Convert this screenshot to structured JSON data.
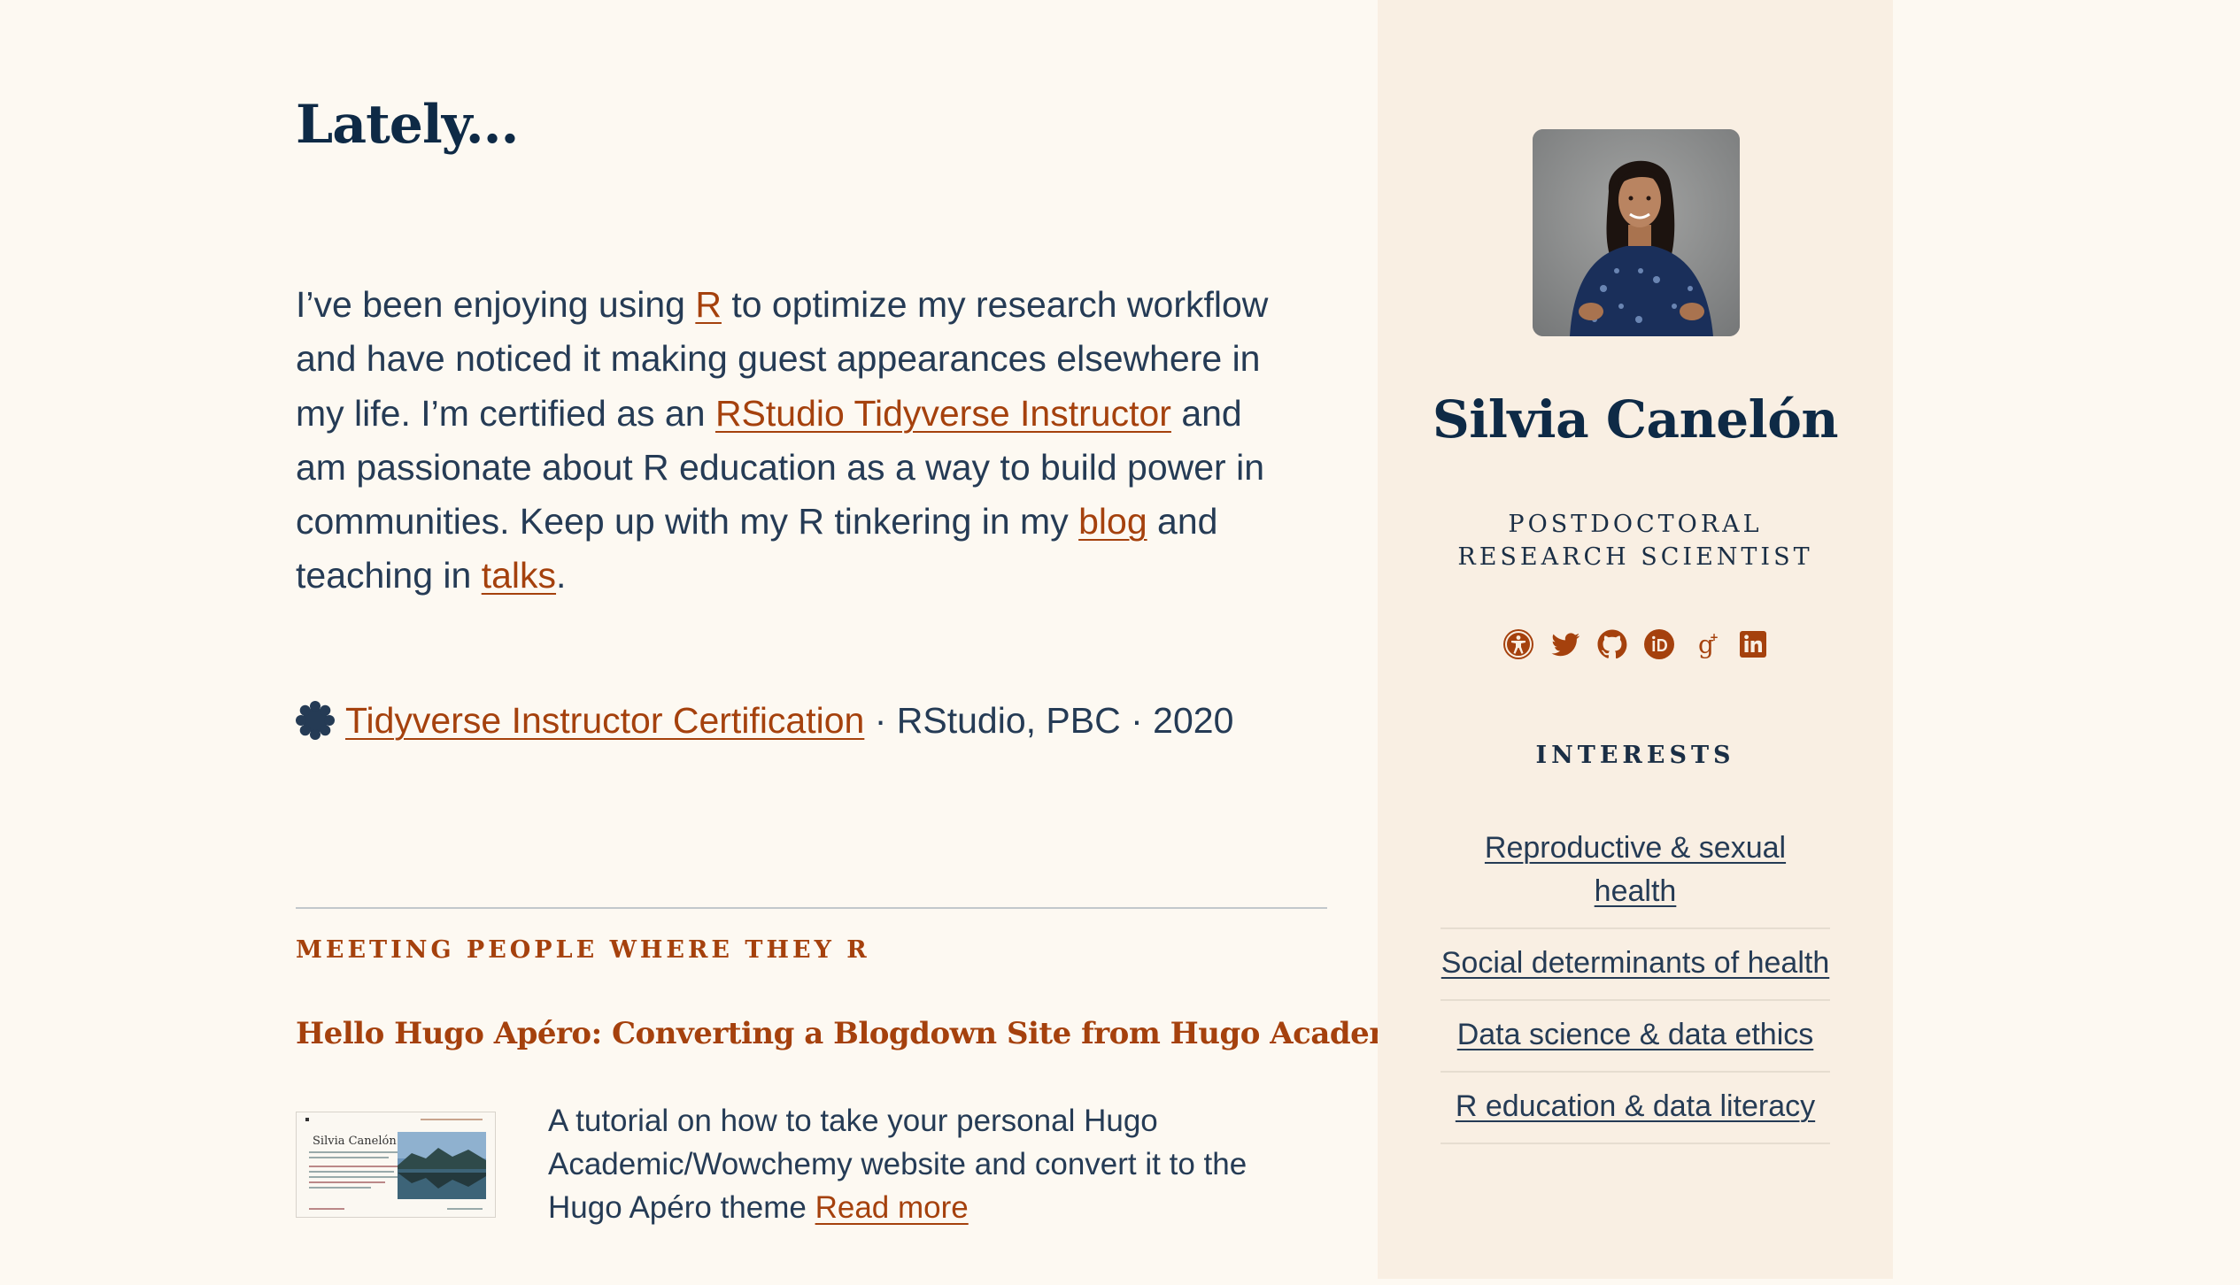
{
  "main": {
    "heading": "Lately...",
    "intro": {
      "part1": "I’ve been enjoying using ",
      "link_r": "R",
      "part2": " to optimize my research workflow and have noticed it making guest appearances elsewhere in my life. I’m certified as an ",
      "link_instructor": "RStudio Tidyverse Instructor",
      "part3": " and am passionate about R education as a way to build power in communities. Keep up with my R tinkering in my ",
      "link_blog": "blog",
      "part4": " and teaching in ",
      "link_talks": "talks",
      "part5": "."
    },
    "certification": {
      "icon": "certificate-badge-icon",
      "link": "Tidyverse Instructor Certification",
      "issuer": " · RStudio, PBC · 2020"
    },
    "section": {
      "kicker": "MEETING PEOPLE WHERE THEY R",
      "post_title": "Hello Hugo Apéro: Converting a Blogdown Site from Hugo Academic",
      "summary": "A tutorial on how to take your personal Hugo Academic/Wowchemy website and convert it to the Hugo Apéro theme ",
      "read_more": "Read more",
      "thumbnail_title": "Silvia Canelón"
    }
  },
  "sidebar": {
    "name": "Silvia Canelón",
    "role": "POSTDOCTORAL RESEARCH SCIENTIST",
    "social_icons": [
      "accessibility-icon",
      "twitter-icon",
      "github-icon",
      "orcid-icon",
      "google-scholar-icon",
      "linkedin-icon"
    ],
    "interests_heading": "INTERESTS",
    "interests": [
      "Reproductive & sexual health",
      "Social determinants of health",
      "Data science & data ethics",
      "R education & data literacy"
    ]
  },
  "colors": {
    "accent": "#a5410d",
    "heading": "#0e2a46",
    "body_text": "#253b55",
    "page_bg": "#fdf9f2",
    "sidebar_bg": "#f9efe3"
  }
}
